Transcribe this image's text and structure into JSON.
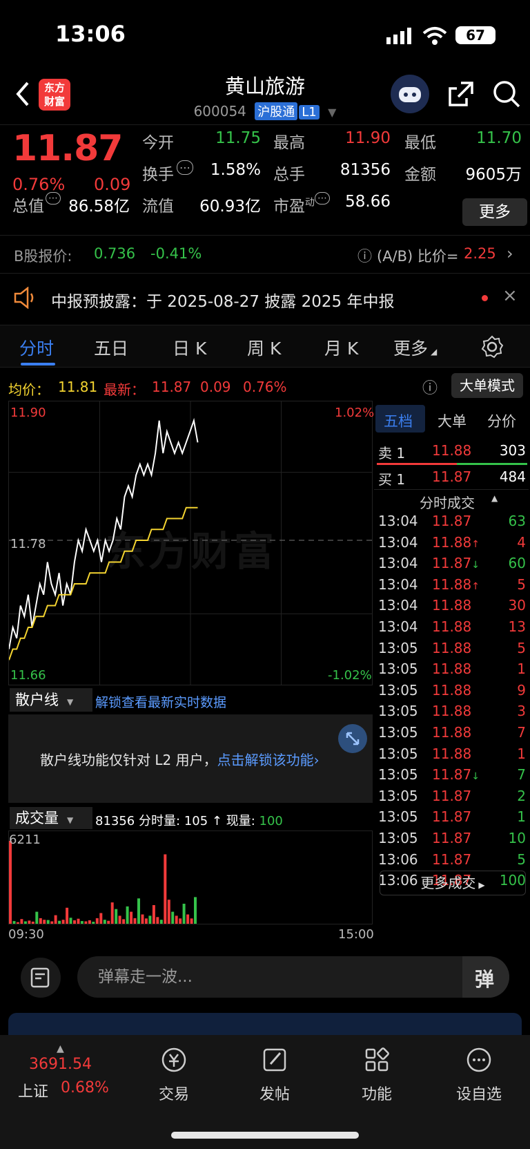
{
  "status_bar": {
    "time": "13:06",
    "battery": "67"
  },
  "header": {
    "logo_text": "东方\n财富",
    "stock_name": "黄山旅游",
    "stock_code": "600054",
    "connect_tag": "沪股通",
    "level_tag": "L1"
  },
  "quote": {
    "price": "11.87",
    "change_pct": "0.76%",
    "change_amt": "0.09",
    "open_label": "今开",
    "open": "11.75",
    "high_label": "最高",
    "high": "11.90",
    "low_label": "最低",
    "low": "11.70",
    "turnover_label": "换手",
    "turnover": "1.58%",
    "volume_label": "总手",
    "volume": "81356",
    "amount_label": "金额",
    "amount": "9605万",
    "total_cap_label": "总值",
    "total_cap": "86.58亿",
    "float_cap_label": "流值",
    "float_cap": "60.93亿",
    "pe_label": "市盈",
    "pe_sup": "动",
    "pe": "58.66",
    "more_label": "更多"
  },
  "bshare": {
    "label": "B股报价:",
    "price": "0.736",
    "change": "-0.41%",
    "ratio_label": "(A/B) 比价=",
    "ratio": "2.25"
  },
  "notice": {
    "text": "中报预披露：于 2025-08-27 披露 2025 年中报"
  },
  "tabs": [
    "分时",
    "五日",
    "日 K",
    "周 K",
    "月 K",
    "更多"
  ],
  "avg_row": {
    "avg_label": "均价：",
    "avg": "11.81",
    "latest_label": "最新：",
    "latest": "11.87",
    "latest_chg": "0.09",
    "latest_pct": "0.76%",
    "bigorder_label": "大单模式"
  },
  "chart_data": {
    "type": "line",
    "y_labels": {
      "top": "11.90",
      "mid": "11.78",
      "bottom": "11.66"
    },
    "pct_labels": {
      "top": "1.02%",
      "bottom": "-1.02%"
    },
    "ylim": [
      11.66,
      11.9
    ],
    "reference_price": 11.78,
    "x_start": "09:30",
    "x_end": "15:00",
    "series": [
      {
        "name": "price",
        "color": "#ffffff",
        "values": [
          11.68,
          11.7,
          11.69,
          11.72,
          11.71,
          11.73,
          11.7,
          11.72,
          11.74,
          11.73,
          11.76,
          11.74,
          11.73,
          11.75,
          11.72,
          11.74,
          11.73,
          11.76,
          11.78,
          11.77,
          11.79,
          11.78,
          11.77,
          11.78,
          11.76,
          11.78,
          11.77,
          11.78,
          11.8,
          11.79,
          11.82,
          11.83,
          11.82,
          11.84,
          11.85,
          11.84,
          11.85,
          11.84,
          11.86,
          11.89,
          11.86,
          11.88,
          11.87,
          11.86,
          11.87,
          11.86,
          11.87,
          11.88,
          11.89,
          11.87
        ]
      },
      {
        "name": "avg",
        "color": "#f4d430",
        "values": [
          11.67,
          11.68,
          11.68,
          11.69,
          11.69,
          11.7,
          11.7,
          11.71,
          11.71,
          11.71,
          11.72,
          11.72,
          11.72,
          11.73,
          11.73,
          11.73,
          11.73,
          11.74,
          11.74,
          11.74,
          11.74,
          11.75,
          11.75,
          11.75,
          11.75,
          11.75,
          11.76,
          11.76,
          11.76,
          11.76,
          11.77,
          11.77,
          11.77,
          11.78,
          11.78,
          11.78,
          11.78,
          11.79,
          11.79,
          11.79,
          11.79,
          11.8,
          11.8,
          11.8,
          11.8,
          11.8,
          11.81,
          11.81,
          11.81,
          11.81
        ]
      }
    ],
    "volume": {
      "max_label": "6211",
      "values": [
        6211,
        200,
        120,
        350,
        180,
        240,
        160,
        900,
        420,
        300,
        280,
        180,
        640,
        220,
        300,
        1200,
        450,
        260,
        380,
        200,
        180,
        260,
        150,
        420,
        800,
        300,
        220,
        1600,
        1100,
        600,
        340,
        1300,
        900,
        420,
        1900,
        700,
        400,
        600,
        1400,
        500,
        300,
        5200,
        1800,
        900,
        600,
        400,
        1500,
        700,
        400,
        2000
      ]
    },
    "watermark": "东方财富"
  },
  "book": {
    "tabs": [
      "五档",
      "大单",
      "分价"
    ],
    "sell1": {
      "label": "卖 1",
      "price": "11.88",
      "vol": "303"
    },
    "buy1": {
      "label": "买 1",
      "price": "11.87",
      "vol": "484"
    },
    "trades_title": "分时成交",
    "trades": [
      {
        "time": "13:04",
        "price": "11.87",
        "arrow": "",
        "vol": "63",
        "volc": "#35c24a"
      },
      {
        "time": "13:04",
        "price": "11.88",
        "arrow": "↑",
        "vol": "4",
        "volc": "#f23a3a"
      },
      {
        "time": "13:04",
        "price": "11.87",
        "arrow": "↓",
        "vol": "60",
        "volc": "#35c24a"
      },
      {
        "time": "13:04",
        "price": "11.88",
        "arrow": "↑",
        "vol": "5",
        "volc": "#f23a3a"
      },
      {
        "time": "13:04",
        "price": "11.88",
        "arrow": "",
        "vol": "30",
        "volc": "#f23a3a"
      },
      {
        "time": "13:04",
        "price": "11.88",
        "arrow": "",
        "vol": "13",
        "volc": "#f23a3a"
      },
      {
        "time": "13:05",
        "price": "11.88",
        "arrow": "",
        "vol": "5",
        "volc": "#f23a3a"
      },
      {
        "time": "13:05",
        "price": "11.88",
        "arrow": "",
        "vol": "1",
        "volc": "#f23a3a"
      },
      {
        "time": "13:05",
        "price": "11.88",
        "arrow": "",
        "vol": "9",
        "volc": "#f23a3a"
      },
      {
        "time": "13:05",
        "price": "11.88",
        "arrow": "",
        "vol": "3",
        "volc": "#f23a3a"
      },
      {
        "time": "13:05",
        "price": "11.88",
        "arrow": "",
        "vol": "7",
        "volc": "#f23a3a"
      },
      {
        "time": "13:05",
        "price": "11.88",
        "arrow": "",
        "vol": "1",
        "volc": "#f23a3a"
      },
      {
        "time": "13:05",
        "price": "11.87",
        "arrow": "↓",
        "vol": "7",
        "volc": "#35c24a"
      },
      {
        "time": "13:05",
        "price": "11.87",
        "arrow": "",
        "vol": "2",
        "volc": "#35c24a"
      },
      {
        "time": "13:05",
        "price": "11.87",
        "arrow": "",
        "vol": "1",
        "volc": "#35c24a"
      },
      {
        "time": "13:05",
        "price": "11.87",
        "arrow": "",
        "vol": "10",
        "volc": "#35c24a"
      },
      {
        "time": "13:06",
        "price": "11.87",
        "arrow": "",
        "vol": "5",
        "volc": "#35c24a"
      },
      {
        "time": "13:06",
        "price": "11.87",
        "arrow": "",
        "vol": "100",
        "volc": "#35c24a"
      }
    ],
    "more_trades": "更多成交"
  },
  "retail": {
    "select_label": "散户线",
    "unlock_link": "解锁查看最新实时数据",
    "msg": "散户线功能仅针对 L2 用户，",
    "msg_link": "点击解锁该功能"
  },
  "volume_bar": {
    "select_label": "成交量",
    "total": "81356",
    "minute_label": "分时量:",
    "minute_val": "105",
    "now_label": "现量:",
    "now_val": "100"
  },
  "danmaku": {
    "placeholder": "弹幕走一波..."
  },
  "bottom_nav": {
    "index_value": "3691.54",
    "index_name": "上证",
    "index_pct": "0.68%",
    "items": [
      "交易",
      "发帖",
      "功能",
      "设自选"
    ]
  }
}
